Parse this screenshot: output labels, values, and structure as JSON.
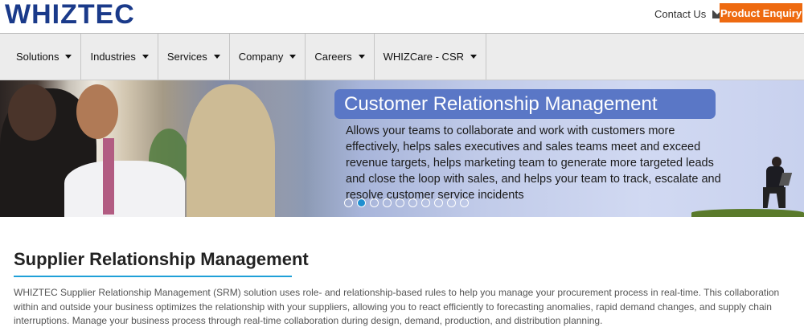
{
  "header": {
    "logo": "WHIZTEC",
    "contact_label": "Contact Us",
    "enquiry_label": "Product Enquiry"
  },
  "nav": {
    "items": [
      {
        "label": "Solutions"
      },
      {
        "label": "Industries"
      },
      {
        "label": "Services"
      },
      {
        "label": "Company"
      },
      {
        "label": "Careers"
      },
      {
        "label": "WHIZCare - CSR"
      }
    ]
  },
  "banner": {
    "title": "Customer Relationship Management",
    "text": "Allows your teams to collaborate and work with customers more effectively, helps sales executives and sales teams meet and exceed revenue targets, helps marketing team to generate more targeted leads and close the loop with sales, and helps your team to track, escalate and resolve customer service incidents",
    "slide_count": 10,
    "active_slide": 2
  },
  "main": {
    "title": "Supplier Relationship Management",
    "body": "WHIZTEC Supplier Relationship Management (SRM) solution uses role- and relationship-based rules to help you manage your procurement process in real-time. This collaboration within and outside your business optimizes the relationship with your suppliers, allowing you to react efficiently to forecasting anomalies, rapid demand changes, and supply chain interruptions. Manage your business process through real-time collaboration during design, demand, production, and distribution planning."
  },
  "colors": {
    "brand": "#1a3a8a",
    "accent": "#ee6a10",
    "title_rule": "#1fa0d8",
    "active_dot": "#1f8fd0"
  }
}
